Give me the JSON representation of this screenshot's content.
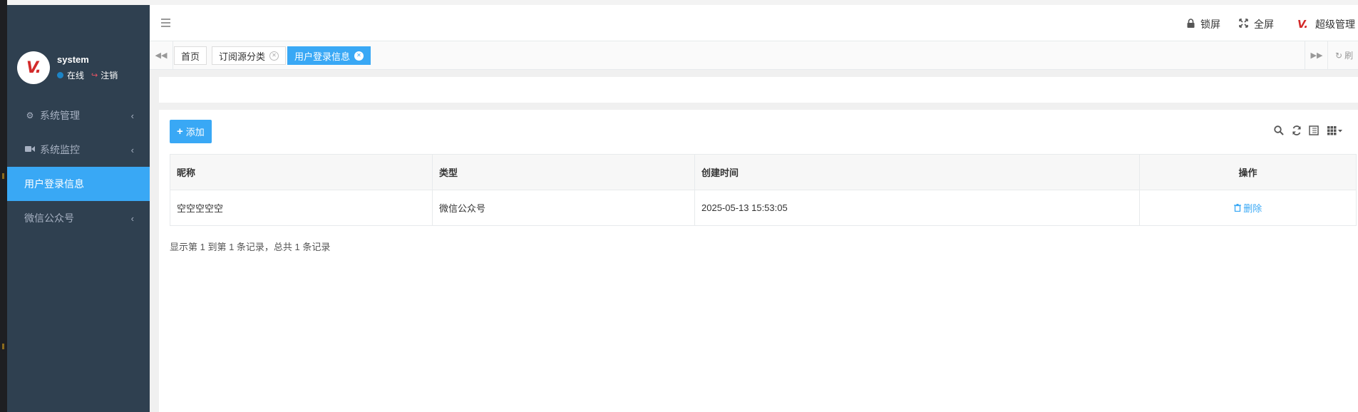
{
  "sidebar": {
    "user": {
      "name": "system",
      "status": "在线",
      "logout": "注销"
    },
    "items": [
      {
        "label": "系统管理",
        "icon": "gear-icon"
      },
      {
        "label": "系统监控",
        "icon": "video-icon"
      },
      {
        "label": "用户登录信息",
        "active": true
      },
      {
        "label": "微信公众号"
      }
    ]
  },
  "header": {
    "lock_label": "锁屏",
    "fullscreen_label": "全屏",
    "admin_label": "超级管理"
  },
  "tabs": [
    {
      "label": "首页",
      "closable": false
    },
    {
      "label": "订阅源分类",
      "closable": true
    },
    {
      "label": "用户登录信息",
      "closable": true,
      "active": true
    }
  ],
  "tabs_refresh_label": "刷",
  "toolbar": {
    "add_label": "添加"
  },
  "table": {
    "columns": [
      "昵称",
      "类型",
      "创建时间",
      "操作"
    ],
    "rows": [
      {
        "nickname": "空空空空空",
        "type": "微信公众号",
        "created": "2025-05-13 15:53:05",
        "action": "删除"
      }
    ]
  },
  "pagination": {
    "summary": "显示第 1 到第 1 条记录，总共 1 条记录"
  },
  "colors": {
    "accent": "#39a8f5",
    "sidebar_bg": "#2f4050",
    "logo_red": "#d32a2a"
  }
}
